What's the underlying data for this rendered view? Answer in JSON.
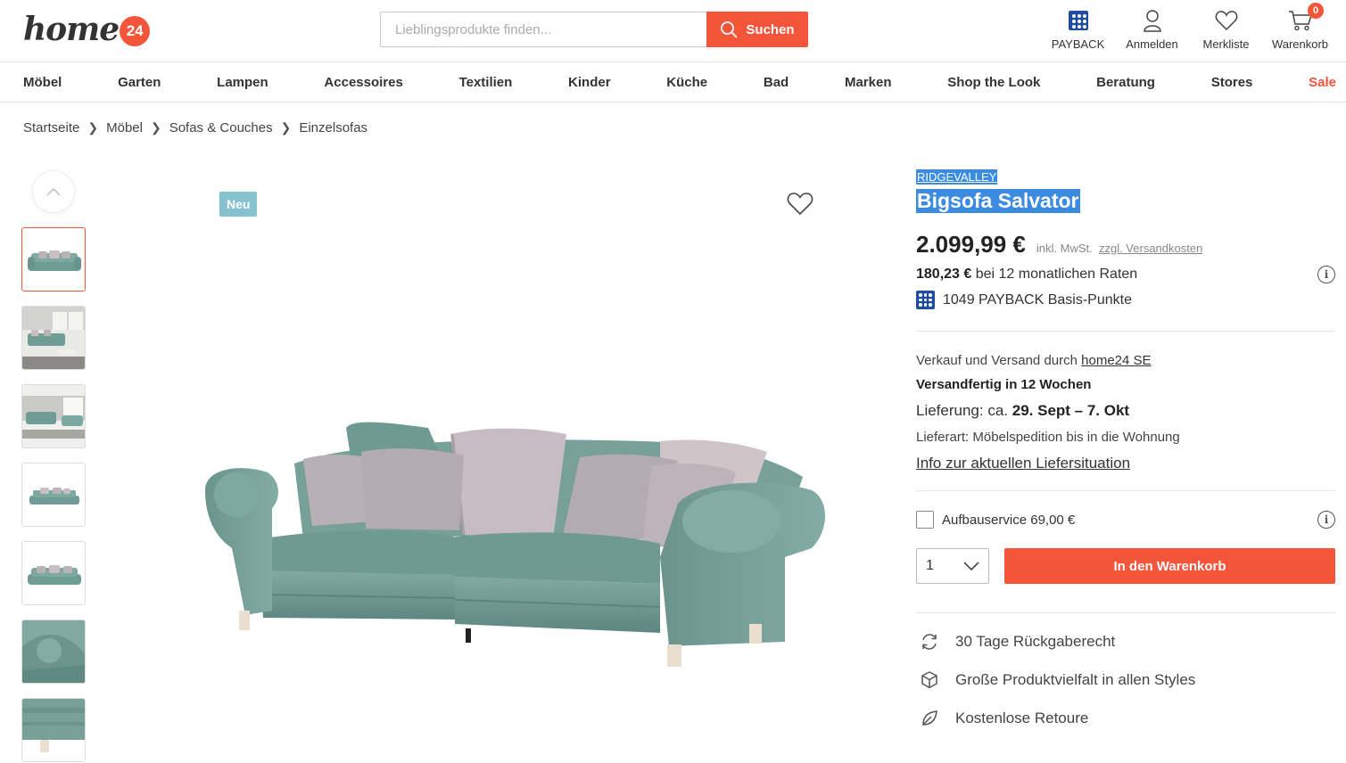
{
  "header": {
    "logo_text": "home",
    "logo_badge": "24",
    "search_placeholder": "Lieblingsprodukte finden...",
    "search_button": "Suchen",
    "actions": [
      {
        "label": "PAYBACK",
        "icon": "payback-icon"
      },
      {
        "label": "Anmelden",
        "icon": "user-icon"
      },
      {
        "label": "Merkliste",
        "icon": "heart-icon"
      },
      {
        "label": "Warenkorb",
        "icon": "cart-icon",
        "badge": "0"
      }
    ]
  },
  "nav": {
    "items": [
      "Möbel",
      "Garten",
      "Lampen",
      "Accessoires",
      "Textilien",
      "Kinder",
      "Küche",
      "Bad",
      "Marken",
      "Shop the Look",
      "Beratung",
      "Stores",
      "Sale"
    ]
  },
  "breadcrumb": [
    "Startseite",
    "Möbel",
    "Sofas & Couches",
    "Einzelsofas"
  ],
  "gallery": {
    "badge": "Neu"
  },
  "product": {
    "brand": "RIDGEVALLEY",
    "title": "Bigsofa Salvator",
    "price": "2.099,99 €",
    "price_note": "inkl. MwSt.",
    "shipping_link": "zzgl. Versandkosten",
    "rate_amount": "180,23 €",
    "rate_text": "bei 12 monatlichen Raten",
    "payback_points": "1049 PAYBACK Basis-Punkte",
    "seller_prefix": "Verkauf und Versand durch",
    "seller_name": "home24 SE",
    "ready": "Versandfertig in 12 Wochen",
    "delivery_prefix": "Lieferung: ca.",
    "delivery_dates": "29. Sept – 7. Okt",
    "delivery_type": "Lieferart: Möbelspedition bis in die Wohnung",
    "delivery_info_link": "Info zur aktuellen Liefersituation",
    "assembly_label": "Aufbauservice 69,00 €",
    "quantity": "1",
    "cart_button": "In den Warenkorb",
    "usps": [
      {
        "icon": "return-icon",
        "text": "30 Tage Rückgaberecht"
      },
      {
        "icon": "box-icon",
        "text": "Große Produktvielfalt in allen Styles"
      },
      {
        "icon": "leaf-icon",
        "text": "Kostenlose Retoure"
      }
    ]
  },
  "colors": {
    "accent": "#f4553a",
    "payback": "#1f4ea1",
    "badge_new": "#86c1d0",
    "selection": "#3b8be0"
  }
}
